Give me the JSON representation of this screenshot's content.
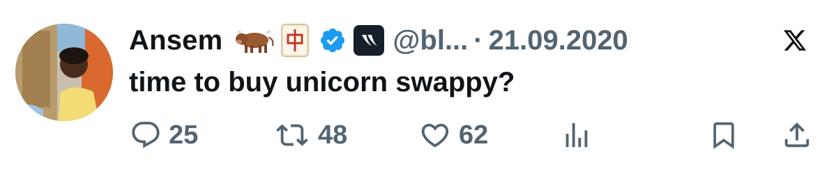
{
  "tweet": {
    "display_name": "Ansem",
    "emojis": [
      "ox-emoji",
      "mahjong-red-dragon-emoji"
    ],
    "handle": "@bl...",
    "separator": "·",
    "date": "21.09.2020",
    "text": "time to buy unicorn swappy?"
  },
  "actions": {
    "replies": "25",
    "retweets": "48",
    "likes": "62"
  },
  "colors": {
    "text": "#0f1419",
    "secondary": "#536471",
    "verified": "#1d9bf0"
  }
}
